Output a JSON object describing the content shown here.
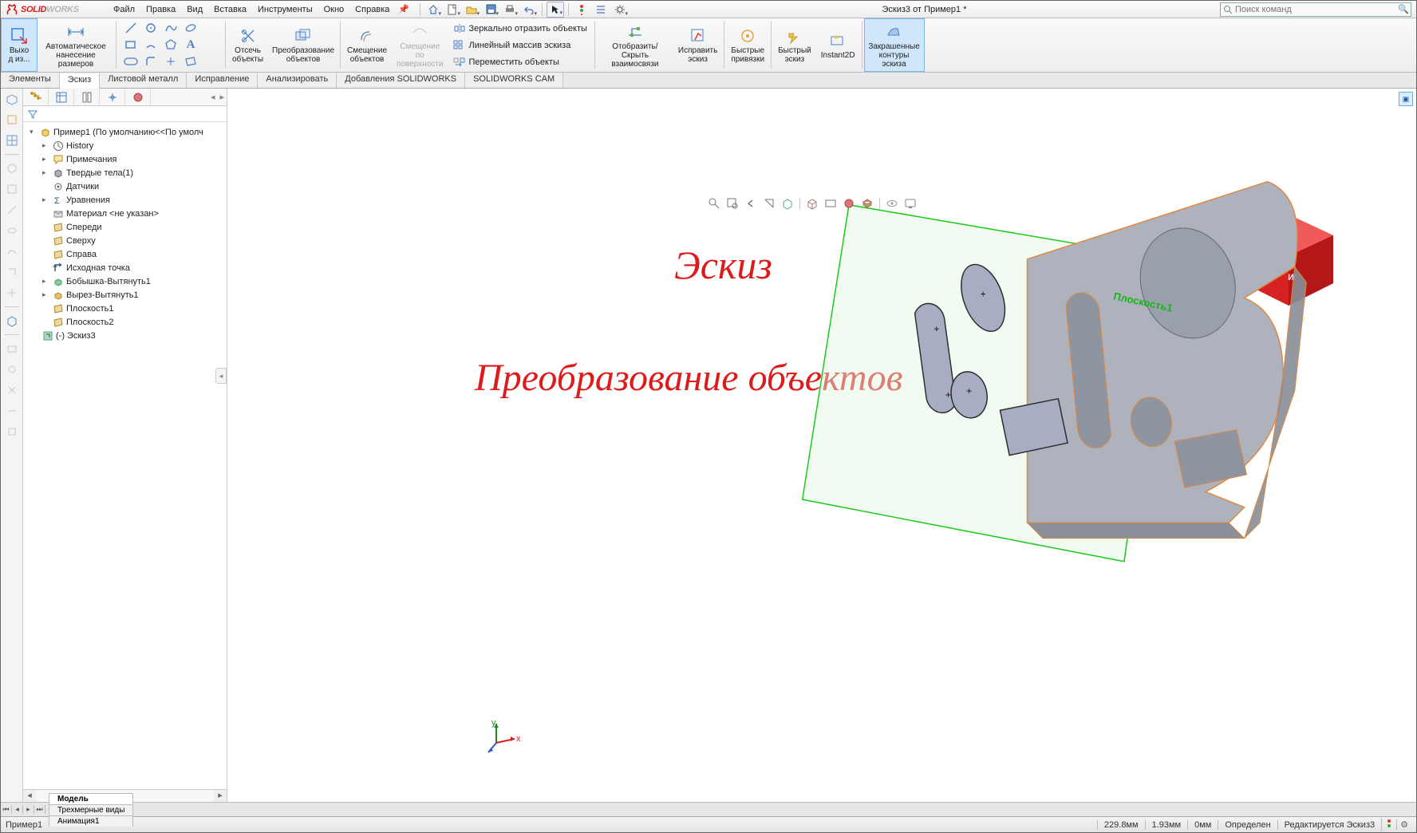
{
  "app": {
    "brand_prefix": "SOLID",
    "brand_suffix": "WORKS",
    "doc_title": "Эскиз3 от Пример1 *",
    "search_placeholder": "Поиск команд"
  },
  "menu": [
    "Файл",
    "Правка",
    "Вид",
    "Вставка",
    "Инструменты",
    "Окно",
    "Справка"
  ],
  "ribbon": {
    "exit": "Выхо\nд из...",
    "smartdim": "Автоматическое\nнанесение размеров",
    "trim": "Отсечь\nобъекты",
    "convert": "Преобразование\nобъектов",
    "offset": "Смещение\nобъектов",
    "offset_surf": "Смещение\nпо\nповерхности",
    "mirror": "Зеркально отразить объекты",
    "linear": "Линейный массив эскиза",
    "move": "Переместить объекты",
    "display_rel": "Отобразить/Скрыть\nвзаимосвязи",
    "repair": "Исправить\nэскиз",
    "quick_snaps": "Быстрые\nпривязки",
    "rapid": "Быстрый\nэскиз",
    "instant": "Instant2D",
    "shaded": "Закрашенные\nконтуры\nэскиза"
  },
  "tabs": [
    "Элементы",
    "Эскиз",
    "Листовой металл",
    "Исправление",
    "Анализировать",
    "Добавления SOLIDWORKS",
    "SOLIDWORKS CAM"
  ],
  "tree": {
    "root": "Пример1  (По умолчанию<<По умолч",
    "items": [
      {
        "icon": "hist",
        "label": "History",
        "exp": true
      },
      {
        "icon": "ann",
        "label": "Примечания",
        "exp": true
      },
      {
        "icon": "solid",
        "label": "Твердые тела(1)",
        "exp": true
      },
      {
        "icon": "sensor",
        "label": "Датчики",
        "exp": false
      },
      {
        "icon": "eq",
        "label": "Уравнения",
        "exp": true
      },
      {
        "icon": "mat",
        "label": "Материал <не указан>",
        "exp": false
      },
      {
        "icon": "plane",
        "label": "Спереди",
        "exp": false
      },
      {
        "icon": "plane",
        "label": "Сверху",
        "exp": false
      },
      {
        "icon": "plane",
        "label": "Справа",
        "exp": false
      },
      {
        "icon": "origin",
        "label": "Исходная точка",
        "exp": false
      },
      {
        "icon": "boss",
        "label": "Бобышка-Вытянуть1",
        "exp": true
      },
      {
        "icon": "cut",
        "label": "Вырез-Вытянуть1",
        "exp": true
      },
      {
        "icon": "plane",
        "label": "Плоскость1",
        "exp": false
      },
      {
        "icon": "plane",
        "label": "Плоскость2",
        "exp": false
      }
    ],
    "sketch": "(-) Эскиз3"
  },
  "annot": {
    "title": "Эскиз",
    "subtitle": "Преобразование объектов",
    "plane": "Плоскость1"
  },
  "btabs": [
    "Модель",
    "Трехмерные виды",
    "Анимация1"
  ],
  "status": {
    "doc": "Пример1",
    "dist": "229.8мм",
    "d2": "1.93мм",
    "d3": "0мм",
    "def": "Определен",
    "edit": "Редактируется Эскиз3"
  }
}
